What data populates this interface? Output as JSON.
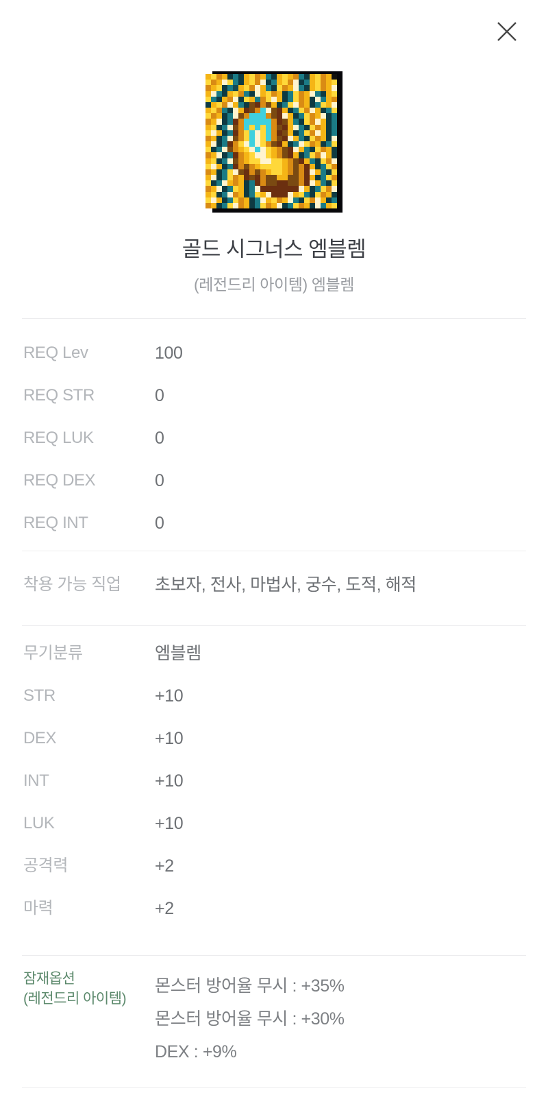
{
  "header": {
    "close_icon": "close-icon"
  },
  "item": {
    "icon_name": "gold-cygnus-emblem-icon",
    "title": "골드 시그너스 엠블렘",
    "subtitle": "(레전드리 아이템) 엠블렘"
  },
  "requirements": {
    "rows": [
      {
        "label": "REQ Lev",
        "value": "100"
      },
      {
        "label": "REQ STR",
        "value": "0"
      },
      {
        "label": "REQ LUK",
        "value": "0"
      },
      {
        "label": "REQ DEX",
        "value": "0"
      },
      {
        "label": "REQ INT",
        "value": "0"
      }
    ]
  },
  "job": {
    "rows": [
      {
        "label": "착용 가능 직업",
        "value": "초보자, 전사, 마법사, 궁수, 도적, 해적"
      }
    ]
  },
  "stats": {
    "rows": [
      {
        "label": "무기분류",
        "value": "엠블렘"
      },
      {
        "label": "STR",
        "value": "+10"
      },
      {
        "label": "DEX",
        "value": "+10"
      },
      {
        "label": "INT",
        "value": "+10"
      },
      {
        "label": "LUK",
        "value": "+10"
      },
      {
        "label": "공격력",
        "value": "+2"
      },
      {
        "label": "마력",
        "value": "+2"
      }
    ]
  },
  "potential": {
    "label_line1": "잠재옵션",
    "label_line2": "(레전드리 아이템)",
    "accent_color": "#5d8a6d",
    "options": [
      "몬스터 방어율 무시 : +35%",
      "몬스터 방어율 무시 : +30%",
      "DEX : +9%"
    ]
  },
  "icon_pixels": {
    "palette": {
      "k": "#11110f",
      "d": "#0e3a42",
      "t": "#1b7b86",
      "c": "#3fd0de",
      "b": "#7a4a12",
      "o": "#d98b14",
      "g": "#f5b516",
      "y": "#ffd83a",
      "w": "#fff4cf",
      "m": "#6b2f10",
      "e": "#154a52"
    },
    "rows": [
      "gyogdtdgyogtdgygotdgyog",
      "yogwytdgyowdtgyowdtgyogy",
      "ogydtegyowgtdyogwtdgyogw",
      "gwtdgyotdwgyogdtyogwtdgy",
      "ytdgowdygtoywgdtyogdwtgo",
      "dgyowgtdbmobgdtywogdtygw",
      "gyotdwgmbocwbmgdtyowgdty",
      "yogdtwbocccobmwgdtyogwdt",
      "ogwdtmocccccombgtdyowgdt",
      "gydtwbocycycobmgwtdyogdt",
      "ywgdtmoycwycombgdtyowgdt",
      "ogdtwboycwycobmwgtdyogdw",
      "gwdtmoywcwyobmgdtwyogdty",
      "ydtwbogywcwygobmwgtdyogd",
      "ogwdtmogywwygobmgdtyowgd",
      "gydtwbogyywwyygobmgtdyow",
      "ywgdtmobogyyyygobomgdtyo",
      "ogdtywbmobogyygobomwgtdy",
      "gwdtyogmbmobbggbbomgdtyo",
      "ydtwgogdtmobbmmbbomwgtdy",
      "ogwdtygdtwmmmmmmmwgdtyow",
      "gydtwogdtygwmmmwgytdyogd",
      "ywgdtyogdtwgyogwtdyowgdt",
      "ogdtywogdtyogwdtyogdwtgy"
    ]
  }
}
